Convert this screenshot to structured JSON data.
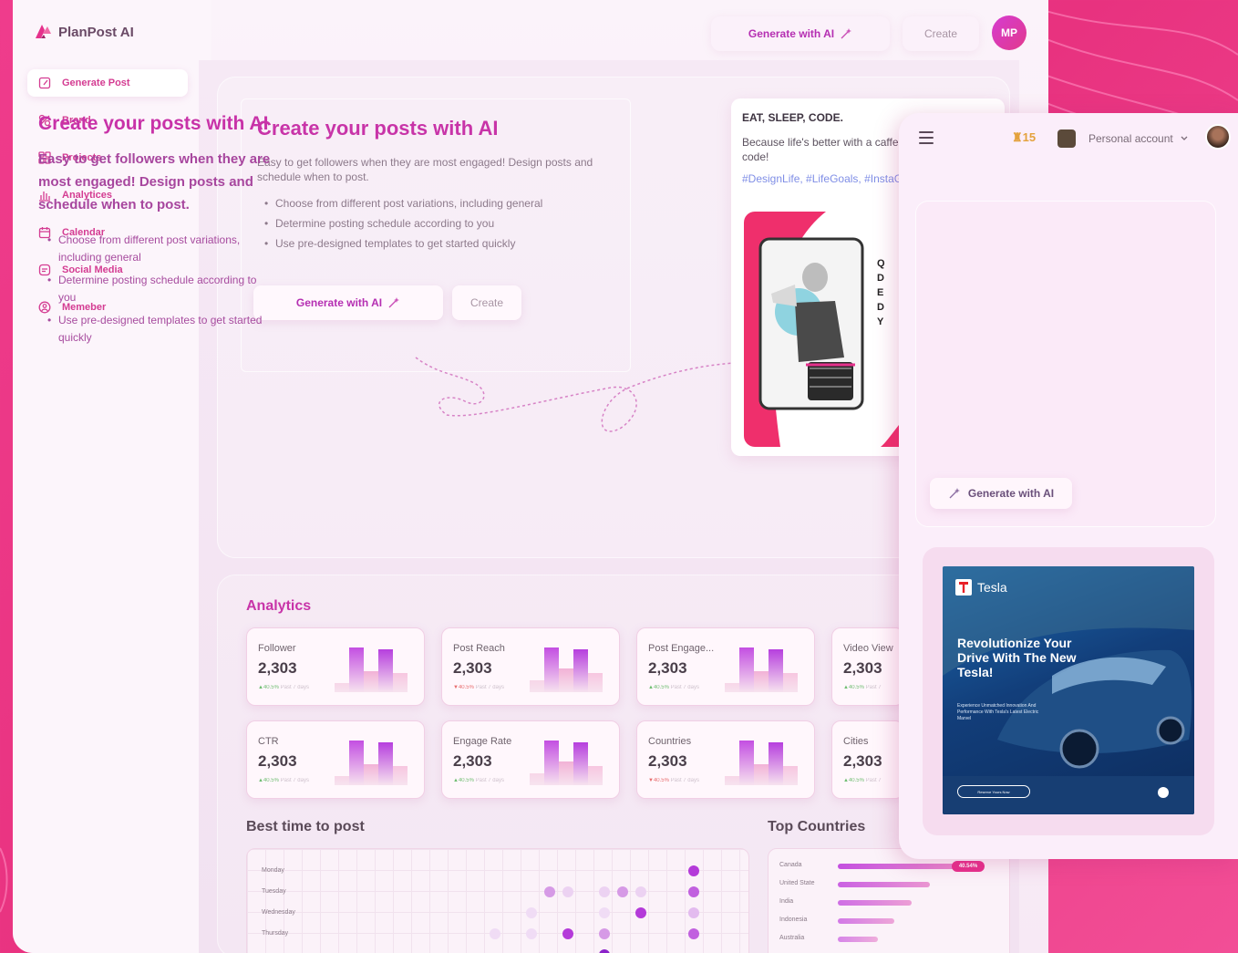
{
  "app": {
    "name": "PlanPost AI"
  },
  "sidebar": {
    "items": [
      {
        "label": "Generate Post",
        "icon": "edit-icon",
        "active": true
      },
      {
        "label": "Brand",
        "icon": "brand-icon"
      },
      {
        "label": "Projects",
        "icon": "grid-icon"
      },
      {
        "label": "Analytices",
        "icon": "chart-icon"
      },
      {
        "label": "Calendar",
        "icon": "calendar-icon"
      },
      {
        "label": "Social Media",
        "icon": "social-icon"
      },
      {
        "label": "Memeber",
        "icon": "user-icon"
      }
    ]
  },
  "topbar": {
    "generate_label": "Generate with AI",
    "create_label": "Create",
    "avatar_initials": "MP"
  },
  "hero": {
    "title": "Create your posts with AI",
    "description": "Easy to get followers when they are most engaged! Design posts and schedule when to post.",
    "bullets": [
      "Choose from different post variations, including general",
      "Determine posting schedule according to you",
      "Use pre-designed templates to get started quickly"
    ],
    "generate_label": "Generate with AI",
    "create_label": "Create"
  },
  "post_preview": {
    "heading": "EAT, SLEEP, CODE.",
    "body": "Because life's better with a caffeine and a lot of code!",
    "tags": "#DesignLife, #LifeGoals, #InstaGood, #LiveYourBe",
    "side_letters": "Q D E D Y"
  },
  "analytics": {
    "title": "Analytics",
    "cards": [
      {
        "label": "Follower",
        "value": "2,303",
        "change": "▲40.5%",
        "period": "Past 7 days",
        "negative": false
      },
      {
        "label": "Post Reach",
        "value": "2,303",
        "change": "▼40.5%",
        "period": "Past 7 days",
        "negative": true
      },
      {
        "label": "Post Engage...",
        "value": "2,303",
        "change": "▲40.5%",
        "period": "Past 7 days",
        "negative": false
      },
      {
        "label": "Video View",
        "value": "2,303",
        "change": "▲40.5%",
        "period": "Past 7",
        "negative": false
      },
      {
        "label": "CTR",
        "value": "2,303",
        "change": "▲40.5%",
        "period": "Past 7 days",
        "negative": false
      },
      {
        "label": "Engage Rate",
        "value": "2,303",
        "change": "▲40.5%",
        "period": "Past 7 days",
        "negative": false
      },
      {
        "label": "Countries",
        "value": "2,303",
        "change": "▼40.5%",
        "period": "Past 7 days",
        "negative": true
      },
      {
        "label": "Cities",
        "value": "2,303",
        "change": "▲40.5%",
        "period": "Past 7",
        "negative": false
      }
    ]
  },
  "best_time": {
    "title": "Best time to post",
    "days": [
      "Monday",
      "Tuesday",
      "Wednesday",
      "Thursday"
    ]
  },
  "top_countries": {
    "title": "Top Countries",
    "badge": "40.54%",
    "rows": [
      {
        "name": "Canada",
        "share": 1.0
      },
      {
        "name": "United State",
        "share": 0.78
      },
      {
        "name": "India",
        "share": 0.62
      },
      {
        "name": "Indonesia",
        "share": 0.48
      },
      {
        "name": "Australia",
        "share": 0.34
      }
    ]
  },
  "phone": {
    "coins": "15",
    "account_label": "Personal account",
    "title": "Create your posts with AI",
    "description": "Easy to get followers when they are most engaged! Design posts and schedule when to post.",
    "bullets": [
      "Choose from different post variations, including general",
      "Determine posting schedule according to you",
      "Use pre-designed templates to get started quickly"
    ],
    "generate_label": "Generate with AI",
    "ad": {
      "brand": "Tesla",
      "headline": "Revolutionize Your Drive With The New Tesla!",
      "subtext": "Experience Unmatched Innovation And Performance With Tesla's Latest Electric Marvel",
      "cta": "Reserve Yours Now"
    }
  },
  "colors": {
    "accent": "#c834a8",
    "brand_pink": "#e8327f"
  }
}
